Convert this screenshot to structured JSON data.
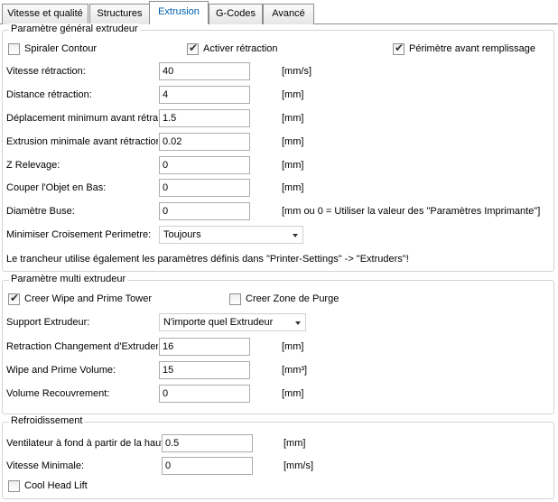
{
  "tabs": [
    "Vitesse et qualité",
    "Structures",
    "Extrusion",
    "G-Codes",
    "Avancé"
  ],
  "groups": {
    "general": {
      "title": "Paramètre général extrudeur",
      "checks": [
        {
          "label": "Spiraler Contour",
          "checked": false
        },
        {
          "label": "Activer rétraction",
          "checked": true
        },
        {
          "label": "Périmètre avant remplissage",
          "checked": true
        }
      ],
      "fields": [
        {
          "label": "Vitesse rétraction:",
          "value": "40",
          "unit": "[mm/s]"
        },
        {
          "label": "Distance rétraction:",
          "value": "4",
          "unit": "[mm]"
        },
        {
          "label": "Déplacement minimum avant rétraction:",
          "value": "1.5",
          "unit": "[mm]"
        },
        {
          "label": "Extrusion minimale avant rétraction:",
          "value": "0.02",
          "unit": "[mm]"
        },
        {
          "label": "Z Relevage:",
          "value": "0",
          "unit": "[mm]"
        },
        {
          "label": "Couper l'Objet en Bas:",
          "value": "0",
          "unit": "[mm]"
        },
        {
          "label": "Diamètre Buse:",
          "value": "0",
          "unit": "[mm ou 0 = Utiliser la valeur des \"Paramètres Imprimante\"]"
        }
      ],
      "crossing": {
        "label": "Minimiser Croisement Perimetre:",
        "value": "Toujours"
      },
      "note": "Le trancheur utilise également les paramètres définis dans \"Printer-Settings\" -> \"Extruders\"!"
    },
    "multi": {
      "title": "Paramètre multi extrudeur",
      "checks": [
        {
          "label": "Creer Wipe and Prime Tower",
          "checked": true
        },
        {
          "label": "Creer Zone de Purge",
          "checked": false
        }
      ],
      "support": {
        "label": "Support Extrudeur:",
        "value": "N'importe quel Extrudeur"
      },
      "fields": [
        {
          "label": "Retraction Changement d'Extruder:",
          "value": "16",
          "unit": "[mm]"
        },
        {
          "label": "Wipe and Prime Volume:",
          "value": "15",
          "unit": "[mm³]"
        },
        {
          "label": "Volume Recouvrement:",
          "value": "0",
          "unit": "[mm]"
        }
      ]
    },
    "cooling": {
      "title": "Refroidissement",
      "fields": [
        {
          "label": "Ventilateur à fond à partir de la hauteur:",
          "value": "0.5",
          "unit": "[mm]"
        },
        {
          "label": "Vitesse Minimale:",
          "value": "0",
          "unit": "[mm/s]"
        }
      ],
      "checks": [
        {
          "label": "Cool Head Lift",
          "checked": false
        }
      ]
    }
  }
}
